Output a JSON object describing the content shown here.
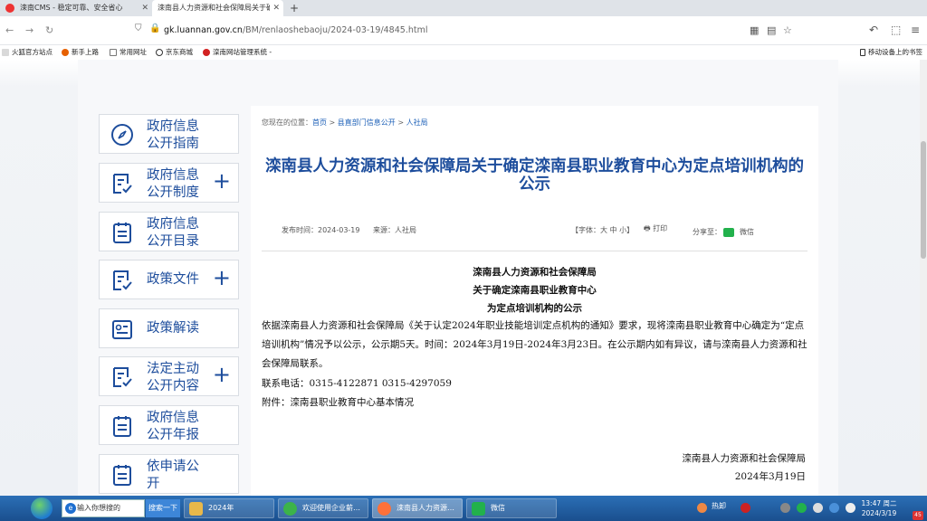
{
  "browser": {
    "tabs": [
      {
        "label": "滦南CMS - 稳定可靠、安全省心"
      },
      {
        "label": "滦南县人力资源和社会保障局关于确定"
      }
    ],
    "new_tab": "+",
    "url_host": "gk.luannan.gov.cn",
    "url_path": "/BM/renlaoshebaoju/2024-03-19/4845.html",
    "bookmarks": [
      {
        "label": "火狐官方站点",
        "color": "#e66000"
      },
      {
        "label": "新手上路",
        "color": "#e66000"
      },
      {
        "label": "常用网址",
        "color": "#777777"
      },
      {
        "label": "京东商城",
        "color": "#333333"
      },
      {
        "label": "滦南网站管理系统",
        "color": "#d22222"
      }
    ],
    "bookmarks_more": "-",
    "mobile_bookmarks": "移动设备上的书签"
  },
  "sidebar": {
    "items": [
      {
        "label": "政府信息公开指南",
        "has_plus": false,
        "icon": "compass-icon"
      },
      {
        "label": "政府信息公开制度",
        "has_plus": true,
        "icon": "document-check-icon"
      },
      {
        "label": "政府信息公开目录",
        "has_plus": false,
        "icon": "list-icon"
      },
      {
        "label": "政策文件",
        "has_plus": true,
        "icon": "document-check-icon"
      },
      {
        "label": "政策解读",
        "has_plus": false,
        "icon": "reader-icon"
      },
      {
        "label": "法定主动公开内容",
        "has_plus": true,
        "icon": "document-check-icon"
      },
      {
        "label": "政府信息公开年报",
        "has_plus": false,
        "icon": "list-icon"
      },
      {
        "label": "依申请公开",
        "has_plus": false,
        "icon": "list-icon"
      }
    ],
    "plus": "+"
  },
  "article": {
    "breadcrumb": {
      "prefix": "您现在的位置：",
      "home": "首页",
      "sep": ">",
      "level2": "县直部门信息公开",
      "level3": "人社局"
    },
    "title": "滦南县人力资源和社会保障局关于确定滦南县职业教育中心为定点培训机构的公示",
    "publish_time": "发布时间：2024-03-19",
    "source": "来源：人社局",
    "font_size": "【字体：大 中 小】",
    "print": "打印",
    "share": "分享至：",
    "wechat": "微信",
    "heading_lines": [
      "滦南县人力资源和社会保障局",
      "关于确定滦南县职业教育中心",
      "为定点培训机构的公示"
    ],
    "body": "依据滦南县人力资源和社会保障局《关于认定2024年职业技能培训定点机构的通知》要求，现将滦南县职业教育中心确定为“定点培训机构”情况予以公示，公示期5天。时间：2024年3月19日-2024年3月23日。在公示期内如有异议，请与滦南县人力资源和社会保障局联系。",
    "phone": "联系电话：0315-4122871    0315-4297059",
    "attachment": "附件：滦南县职业教育中心基本情况",
    "signature_org": "滦南县人力资源和社会保障局",
    "signature_date": "2024年3月19日"
  },
  "taskbar": {
    "ie_input": "输入你想搜的",
    "search_btn": "搜索一下",
    "tasks": [
      {
        "label": "2024年",
        "color": "#e8b84a"
      },
      {
        "label": "欢迎使用企业薪…",
        "color": "#3cb34a"
      },
      {
        "label": "滦南县人力资源…",
        "color": "#ff7139"
      },
      {
        "label": "微信",
        "color": "#22b14c"
      }
    ],
    "tray_labels": [
      "热卸"
    ],
    "time": "13:47 周二",
    "date": "2024/3/19",
    "badge": "45"
  }
}
